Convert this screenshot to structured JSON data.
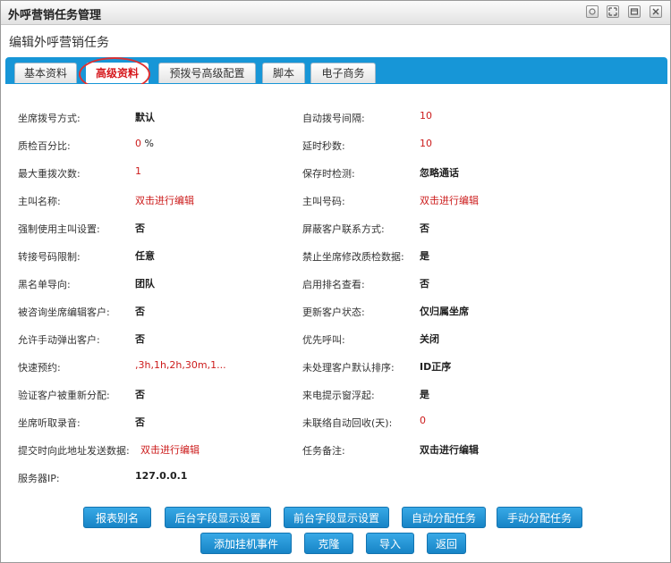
{
  "window": {
    "title": "外呼营销任务管理"
  },
  "page": {
    "subtitle": "编辑外呼营销任务"
  },
  "tabs": [
    {
      "label": "基本资料"
    },
    {
      "label": "高级资料"
    },
    {
      "label": "预拨号高级配置"
    },
    {
      "label": "脚本"
    },
    {
      "label": "电子商务"
    }
  ],
  "fields_left": [
    {
      "label": "坐席拨号方式:",
      "value": "默认"
    },
    {
      "label": "质检百分比:",
      "value": "0",
      "unit": "%"
    },
    {
      "label": "最大重拨次数:",
      "value": "1"
    },
    {
      "label": "主叫名称:",
      "value": "双击进行编辑"
    },
    {
      "label": "强制使用主叫设置:",
      "value": "否"
    },
    {
      "label": "转接号码限制:",
      "value": "任意"
    },
    {
      "label": "黑名单导向:",
      "value": "团队"
    },
    {
      "label": "被咨询坐席编辑客户:",
      "value": "否"
    },
    {
      "label": "允许手动弹出客户:",
      "value": "否"
    },
    {
      "label": "快速预约:",
      "value": ",3h,1h,2h,30m,1..."
    },
    {
      "label": "验证客户被重新分配:",
      "value": "否"
    },
    {
      "label": "坐席听取录音:",
      "value": "否"
    },
    {
      "label": "提交时向此地址发送数据:",
      "value": "双击进行编辑"
    },
    {
      "label": "服务器IP:",
      "value": "127.0.0.1"
    }
  ],
  "fields_right": [
    {
      "label": "自动拨号间隔:",
      "value": "10"
    },
    {
      "label": "延时秒数:",
      "value": "10"
    },
    {
      "label": "保存时检测:",
      "value": "忽略通话"
    },
    {
      "label": "主叫号码:",
      "value": "双击进行编辑"
    },
    {
      "label": "屏蔽客户联系方式:",
      "value": "否"
    },
    {
      "label": "禁止坐席修改质检数据:",
      "value": "是"
    },
    {
      "label": "启用排名查看:",
      "value": "否"
    },
    {
      "label": "更新客户状态:",
      "value": "仅归属坐席"
    },
    {
      "label": "优先呼叫:",
      "value": "关闭"
    },
    {
      "label": "未处理客户默认排序:",
      "value": "ID正序"
    },
    {
      "label": "来电提示窗浮起:",
      "value": "是"
    },
    {
      "label": "未联络自动回收(天):",
      "value": "0"
    },
    {
      "label": "任务备注:",
      "value": "双击进行编辑"
    }
  ],
  "buttons": {
    "report_alias": "报表别名",
    "backend_fields": "后台字段显示设置",
    "frontend_fields": "前台字段显示设置",
    "auto_assign": "自动分配任务",
    "manual_assign": "手动分配任务",
    "add_hangup_event": "添加挂机事件",
    "clone": "克隆",
    "import": "导入",
    "back": "返回"
  },
  "colors": {
    "tab_bar": "#1796d7",
    "button": "#1e8fd3",
    "red_value": "#cc1b1b",
    "annotation": "#e03030"
  },
  "icons": [
    "restore-icon",
    "maximize-icon",
    "minimize-icon",
    "close-icon"
  ]
}
